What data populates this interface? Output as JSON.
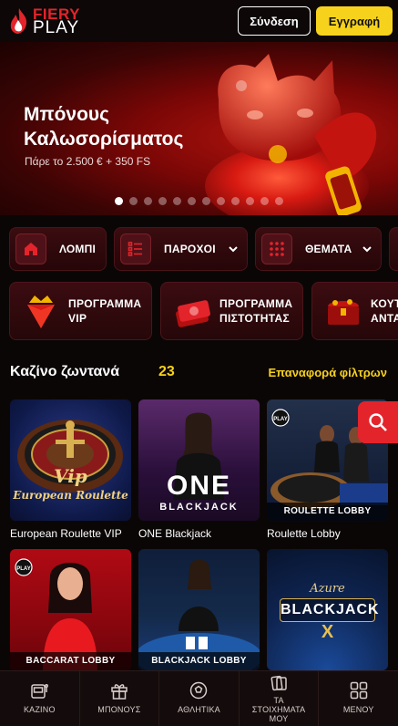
{
  "header": {
    "logo_top": "FIERY",
    "logo_bottom": "PLAY",
    "login_label": "Σύνδεση",
    "register_label": "Εγγραφή",
    "accent": "#f7d21c",
    "brand": "#e3242b"
  },
  "hero": {
    "title": "Μπόνους Καλωσορίσματος",
    "subtitle": "Πάρε το 2.500 € + 350 FS",
    "slide_count": 12,
    "active_slide": 1
  },
  "nav_chips": [
    {
      "label": "ΛΟΜΠΙ",
      "icon": "home-icon"
    },
    {
      "label": "ΠΑΡΟΧΟΙ",
      "icon": "list-icon"
    },
    {
      "label": "ΘΕΜΑΤΑ",
      "icon": "grid-dots-icon"
    }
  ],
  "promos": [
    {
      "line1": "ΠΡΟΓΡΑΜΜΑ",
      "line2": "VIP",
      "icon": "ruby-crown-icon"
    },
    {
      "line1": "ΠΡΟΓΡΑΜΜΑ",
      "line2": "ΠΙΣΤΟΤΗΤΑΣ",
      "icon": "cash-stack-icon"
    },
    {
      "line1": "ΚΟΥΤ",
      "line2": "ΑΝΤΑ",
      "icon": "treasure-chest-icon"
    }
  ],
  "section": {
    "title": "Καζίνο ζωντανά",
    "count": "23",
    "reset": "Επαναφορά φίλτρων"
  },
  "games": [
    {
      "name": "European Roulette VIP",
      "banner": ""
    },
    {
      "name": "ONE Blackjack",
      "banner": ""
    },
    {
      "name": "Roulette Lobby",
      "banner": "ROULETTE LOBBY"
    },
    {
      "name": "",
      "banner": "BACCARAT LOBBY"
    },
    {
      "name": "",
      "banner": "BLACKJACK LOBBY"
    },
    {
      "name": "",
      "banner": ""
    }
  ],
  "thumb_text": {
    "vip_line1": "Vip",
    "vip_line2": "European Roulette",
    "one_big": "ONE",
    "one_sub": "BLACKJACK",
    "azure": "Azure",
    "azure_bj": "BLACKJACK",
    "azure_x": "X",
    "play_badge": "PLAY"
  },
  "bottom_nav": [
    {
      "label": "ΚΑΖΙΝΟ",
      "icon": "slot-machine-icon"
    },
    {
      "label": "ΜΠΟΝΟΥΣ",
      "icon": "gift-icon"
    },
    {
      "label": "ΑΘΛΗΤΙΚΑ",
      "icon": "soccer-ball-icon"
    },
    {
      "label": "ΤΑ ΣΤΟΙΧΗΜΑΤΑ ΜΟΥ",
      "icon": "bet-slip-icon"
    },
    {
      "label": "ΜΕΝΟΥ",
      "icon": "menu-grid-icon"
    }
  ]
}
